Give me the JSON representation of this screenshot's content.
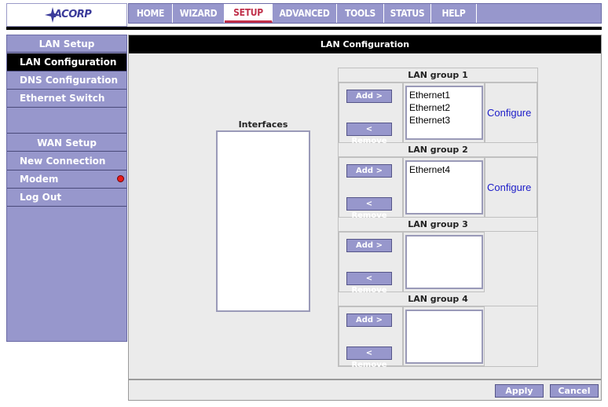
{
  "brand": {
    "logo_text": "ACORP"
  },
  "nav": {
    "tabs": [
      {
        "label": "HOME"
      },
      {
        "label": "WIZARD"
      },
      {
        "label": "SETUP",
        "active": true
      },
      {
        "label": "ADVANCED"
      },
      {
        "label": "TOOLS"
      },
      {
        "label": "STATUS"
      },
      {
        "label": "HELP"
      }
    ]
  },
  "sidebar": {
    "lan_header": "LAN Setup",
    "lan_items": [
      {
        "label": "LAN Configuration",
        "active": true
      },
      {
        "label": "DNS Configuration"
      },
      {
        "label": "Ethernet Switch"
      }
    ],
    "wan_header": "WAN Setup",
    "wan_items": [
      {
        "label": "New Connection"
      },
      {
        "label": "Modem",
        "status": "red-status-dot"
      },
      {
        "label": "Log Out"
      }
    ]
  },
  "main": {
    "title": "LAN Configuration",
    "interfaces_label": "Interfaces",
    "interfaces": [],
    "groups": [
      {
        "title": "LAN group 1",
        "add_label": "Add >",
        "remove_label": "< Remove",
        "members": [
          "Ethernet1",
          "Ethernet2",
          "Ethernet3"
        ],
        "configure_label": "Configure"
      },
      {
        "title": "LAN group 2",
        "add_label": "Add >",
        "remove_label": "< Remove",
        "members": [
          "Ethernet4"
        ],
        "configure_label": "Configure"
      },
      {
        "title": "LAN group 3",
        "add_label": "Add >",
        "remove_label": "< Remove",
        "members": []
      },
      {
        "title": "LAN group 4",
        "add_label": "Add >",
        "remove_label": "< Remove",
        "members": []
      }
    ]
  },
  "footer": {
    "apply_label": "Apply",
    "cancel_label": "Cancel"
  },
  "colors": {
    "accent": "#9797cc",
    "active_tab": "#c0304a",
    "link": "#1c1cc8",
    "status_dot": "#e81c1c"
  }
}
